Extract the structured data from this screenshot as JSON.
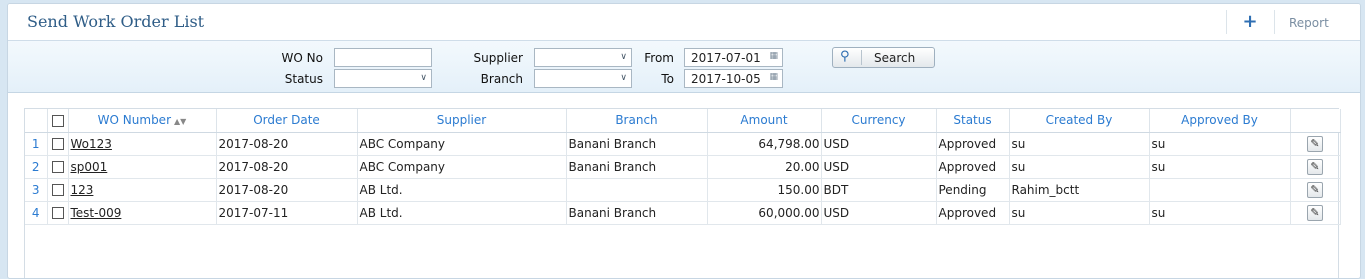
{
  "header": {
    "title": "Send Work Order List",
    "add_icon": "plus-icon",
    "report_label": "Report"
  },
  "filters": {
    "wo_no_label": "WO No",
    "wo_no_value": "",
    "status_label": "Status",
    "status_value": "",
    "supplier_label": "Supplier",
    "supplier_value": "",
    "branch_label": "Branch",
    "branch_value": "",
    "from_label": "From",
    "from_value": "2017-07-01",
    "to_label": "To",
    "to_value": "2017-10-05",
    "search_label": "Search"
  },
  "table": {
    "columns": [
      "WO Number",
      "Order Date",
      "Supplier",
      "Branch",
      "Amount",
      "Currency",
      "Status",
      "Created By",
      "Approved By"
    ],
    "rows": [
      {
        "n": "1",
        "wo": "Wo123",
        "date": "2017-08-20",
        "supplier": "ABC Company",
        "branch": "Banani Branch",
        "amount": "64,798.00",
        "currency": "USD",
        "status": "Approved",
        "created": "su",
        "approved": "su"
      },
      {
        "n": "2",
        "wo": "sp001",
        "date": "2017-08-20",
        "supplier": "ABC Company",
        "branch": "Banani Branch",
        "amount": "20.00",
        "currency": "USD",
        "status": "Approved",
        "created": "su",
        "approved": "su"
      },
      {
        "n": "3",
        "wo": "123",
        "date": "2017-08-20",
        "supplier": "AB Ltd.",
        "branch": "",
        "amount": "150.00",
        "currency": "BDT",
        "status": "Pending",
        "created": "Rahim_bctt",
        "approved": ""
      },
      {
        "n": "4",
        "wo": "Test-009",
        "date": "2017-07-11",
        "supplier": "AB Ltd.",
        "branch": "Banani Branch",
        "amount": "60,000.00",
        "currency": "USD",
        "status": "Approved",
        "created": "su",
        "approved": "su"
      }
    ]
  }
}
